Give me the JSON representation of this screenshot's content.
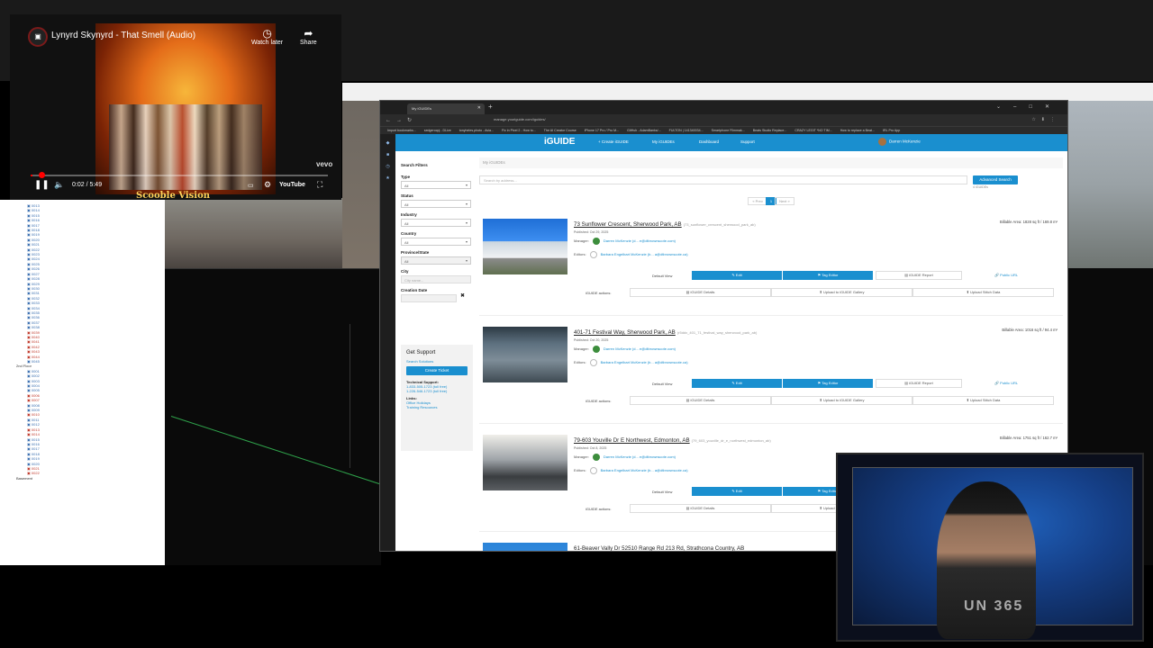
{
  "youtube": {
    "title": "Lynyrd Skynyrd - That Smell (Audio)",
    "watch_later": "Watch later",
    "share": "Share",
    "time": "0:02 / 5:49",
    "progress": 0.006,
    "vevo": "vevo",
    "youtube_label": "YouTube",
    "watermark": "Scooble Vision"
  },
  "tree": {
    "items": [
      "0013",
      "0014",
      "0015",
      "0016",
      "0017",
      "0018",
      "0019",
      "0020",
      "0021",
      "0022",
      "0023",
      "0024",
      "0025",
      "0026",
      "0027",
      "0028",
      "0029",
      "0030",
      "0031",
      "0032",
      "0033",
      "0034",
      "0035",
      "0036",
      "0037",
      "0038",
      "0039",
      "0040",
      "0041",
      "0042",
      "0043",
      "0044",
      "0045"
    ],
    "floor_label": "2nd Floor",
    "items2": [
      "0001",
      "0002",
      "0003",
      "0004",
      "0005",
      "0006",
      "0007",
      "0008",
      "0009",
      "0010",
      "0011",
      "0012",
      "0013",
      "0014",
      "0015",
      "0016",
      "0017",
      "0018",
      "0019",
      "0020",
      "0021",
      "0022"
    ],
    "basement_label": "Basement"
  },
  "browser": {
    "tab_title": "My iGUIDEs",
    "url": "manage.youriguide.com/iguides/",
    "bookmarks": [
      "Import bookmarks...",
      "sedgerocpj - DLive",
      "tonyheles.photo - Avia...",
      "Fix in Pixel 2 - How to...",
      "The AI Creator Course",
      "iPhone 17 Pro / Pro M...",
      "GitHub - AdamBanks/...",
      "FULTON | 141340034...",
      "Smartphone Filmmak...",
      "Beats Studio Replace...",
      "CRAZY LEGIT *NO TIM...",
      "How to replace a Beat...",
      "IRL Pro App"
    ]
  },
  "appnav": {
    "logo": "iGUIDE",
    "items": [
      "+ Create iGUIDE",
      "My iGUIDEs",
      "Dashboard",
      "Support"
    ],
    "user": "Darren McKenzie"
  },
  "filters": {
    "title": "Search Filters",
    "type_label": "Type",
    "type_value": "All",
    "status_label": "Status",
    "status_value": "All",
    "industry_label": "Industry",
    "industry_value": "All",
    "country_label": "Country",
    "country_value": "All",
    "province_label": "Province/State",
    "province_value": "All",
    "city_label": "City",
    "city_placeholder": "City name...",
    "creation_label": "Creation Date"
  },
  "support": {
    "title": "Get Support",
    "search_solutions": "Search Solutions",
    "create_ticket": "Create Ticket",
    "tech_support": "Technical Support:",
    "phone1": "1-833-505-1723 (toll free)",
    "phone2": "1-226-546-1723 (toll free)",
    "links": "Links:",
    "link1": "Office Holidays",
    "link2": "Training Resources"
  },
  "content": {
    "crumb": "My iGUIDEs",
    "search_placeholder": "Search by address...",
    "advanced": "Advanced Search",
    "count": "4 iGUIDEs",
    "pager": [
      "« Prev",
      "1",
      "Next »"
    ]
  },
  "listing_labels": {
    "manager": "Manager:",
    "editors": "Editors:",
    "default_view": "Default View",
    "edit": "Edit",
    "tag_editor": "Tag Editor",
    "report": "iGUIDE Report",
    "public_url": "Public URL",
    "actions": "iGUIDE actions:",
    "details": "iGUIDE Details",
    "upload_gallery": "Upload to iGUIDE Gallery",
    "upload_stitch": "Upload Stitch Data"
  },
  "listings": [
    {
      "title": "73 Sunflower Crescent, Sherwood Park, AB",
      "slug": "(73_sunflower_crescent_sherwood_park_ab)",
      "published": "Published: Oct 29, 2025",
      "billable": "Billable Area: 1828 sq ft / 169.8 m²",
      "manager": "Darren McKenzie (d... e@dtbrownscote.com)",
      "editor": "Barbara Engelbart McKenzie (b... a@dtbrownscote.ca)"
    },
    {
      "title": "401-71 Festival Way, Sherwood Park, AB",
      "slug": "(r5ddx_401_71_festival_way_sherwood_park_ab)",
      "published": "Published: Oct 20, 2025",
      "billable": "Billable Area: 1016 sq ft / 94.4 m²",
      "manager": "Darren McKenzie (d... e@dtbrownscote.com)",
      "editor": "Barbara Engelbart McKenzie (b... a@dtbrownscote.ca)"
    },
    {
      "title": "79-603 Youville Dr E Northwest, Edmonton, AB",
      "slug": "(79_603_youville_dr_e_northwest_edmonton_ab)",
      "published": "Published: Oct 8, 2025",
      "billable": "Billable Area: 1751 sq ft / 162.7 m²",
      "manager": "Darren McKenzie (d... e@dtbrownscote.com)",
      "editor": "Barbara Engelbart McKenzie (b... a@dtbrownscote.ca)"
    },
    {
      "title": "61-Beaver Vally Dr 52510 Range Rd 213 Rd, Strathcona Country, AB"
    }
  ],
  "webcam": {
    "shirt_text": "UN 365"
  }
}
